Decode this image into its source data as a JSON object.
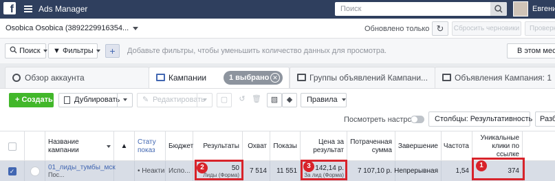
{
  "topbar": {
    "logo": "f",
    "app_title": "Ads Manager",
    "search_placeholder": "Поиск",
    "user_name": "Евгений"
  },
  "account_bar": {
    "account": "Osobica Osobica (3892229916354...",
    "updated": "Обновлено только что",
    "reset_drafts": "Сбросить черновики",
    "review": "Проверк"
  },
  "filter_bar": {
    "search": "Поиск",
    "filters": "Фильтры",
    "hint": "Добавьте фильтры, чтобы уменьшить количество данных для просмотра.",
    "date_range": "В этом месяц"
  },
  "tabs": [
    {
      "label": "Обзор аккаунта"
    },
    {
      "label": "Кампании",
      "selected_pill": "1 выбрано"
    },
    {
      "label": "Группы объявлений Кампани..."
    },
    {
      "label": "Объявления Кампания: 1"
    }
  ],
  "toolbar": {
    "create": "+ Создать",
    "duplicate": "Дублировать",
    "edit": "Редактировать",
    "rules": "Правила",
    "view_settings": "Посмотреть настройки",
    "columns": "Столбцы: Результативность",
    "breakdown": "Разби"
  },
  "table": {
    "headers": {
      "name": "Название кампании",
      "status": "Стату показ",
      "budget": "Бюджет",
      "results": "Результаты",
      "reach": "Охват",
      "impressions": "Показы",
      "cost_per_result": "Цена за результат",
      "spent": "Потраченная сумма",
      "ends": "Завершение",
      "frequency": "Частота",
      "unique_clicks": "Уникальные клики по ссылке"
    },
    "row": {
      "name": "01_лиды_тумбы_мск",
      "name_sub": "Пос...",
      "status": "Неактив",
      "budget": "Испо...",
      "results": "50",
      "results_sub": "Лиды (Форма)",
      "reach": "7 514",
      "impressions": "11 551",
      "cost_per_result": "142,14 р.",
      "cost_sub": "За лид (Форма)",
      "spent": "7 107,10 р.",
      "ends": "Непрерывная",
      "frequency": "1,54",
      "unique_clicks": "374"
    }
  },
  "annotations": [
    "1",
    "2",
    "3"
  ],
  "colors": {
    "topbar": "#2f3f5e",
    "accent": "#4267b2",
    "create": "#42b72a",
    "mark": "#d8232a"
  }
}
